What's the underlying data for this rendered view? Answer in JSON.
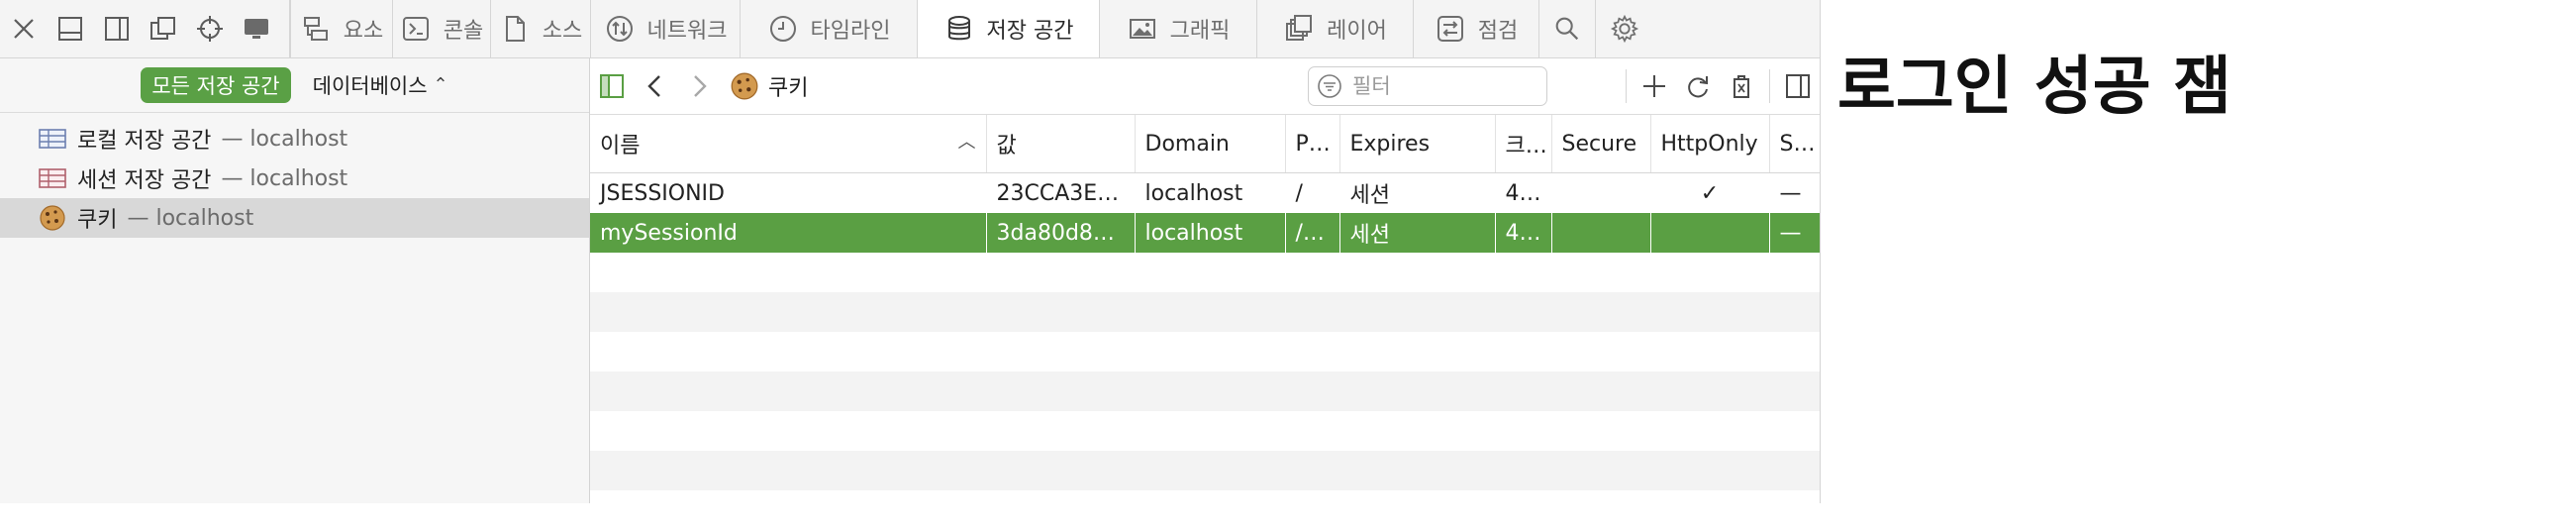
{
  "tabs": [
    {
      "label": "요소",
      "icon": "elements-icon",
      "active": false
    },
    {
      "label": "콘솔",
      "icon": "console-icon",
      "active": false
    },
    {
      "label": "소스",
      "icon": "sources-icon",
      "active": false
    },
    {
      "label": "네트워크",
      "icon": "network-icon",
      "active": false
    },
    {
      "label": "타임라인",
      "icon": "timeline-icon",
      "active": false
    },
    {
      "label": "저장 공간",
      "icon": "storage-icon",
      "active": true
    },
    {
      "label": "그래픽",
      "icon": "graphics-icon",
      "active": false
    },
    {
      "label": "레이어",
      "icon": "layers-icon",
      "active": false
    },
    {
      "label": "점검",
      "icon": "audit-icon",
      "active": false
    }
  ],
  "sidebar": {
    "scope_pill": "모든 저장 공간",
    "db_select": "데이터베이스",
    "items": [
      {
        "label": "로컬 저장 공간",
        "host": "— localhost",
        "icon": "local-storage-icon"
      },
      {
        "label": "세션 저장 공간",
        "host": "— localhost",
        "icon": "session-storage-icon"
      },
      {
        "label": "쿠키",
        "host": "— localhost",
        "icon": "cookie-icon",
        "selected": true
      }
    ]
  },
  "content": {
    "crumb": "쿠키",
    "filter_placeholder": "필터",
    "columns": [
      "이름",
      "값",
      "Domain",
      "P…",
      "Expires",
      "크…",
      "Secure",
      "HttpOnly",
      "S…"
    ],
    "rows": [
      {
        "name": "JSESSIONID",
        "value": "23CCA3E…",
        "domain": "localhost",
        "path": "/",
        "expires": "세션",
        "size": "4…",
        "secure": "",
        "httponly": "✓",
        "samesite": "—"
      },
      {
        "name": "mySessionId",
        "value": "3da80d8…",
        "domain": "localhost",
        "path": "/…",
        "expires": "세션",
        "size": "4…",
        "secure": "",
        "httponly": "",
        "samesite": "—"
      }
    ]
  },
  "page": {
    "heading": "로그인 성공 잼"
  },
  "colors": {
    "accent_green": "#5a9f43",
    "toolbar_bg": "#f4f4f4"
  }
}
